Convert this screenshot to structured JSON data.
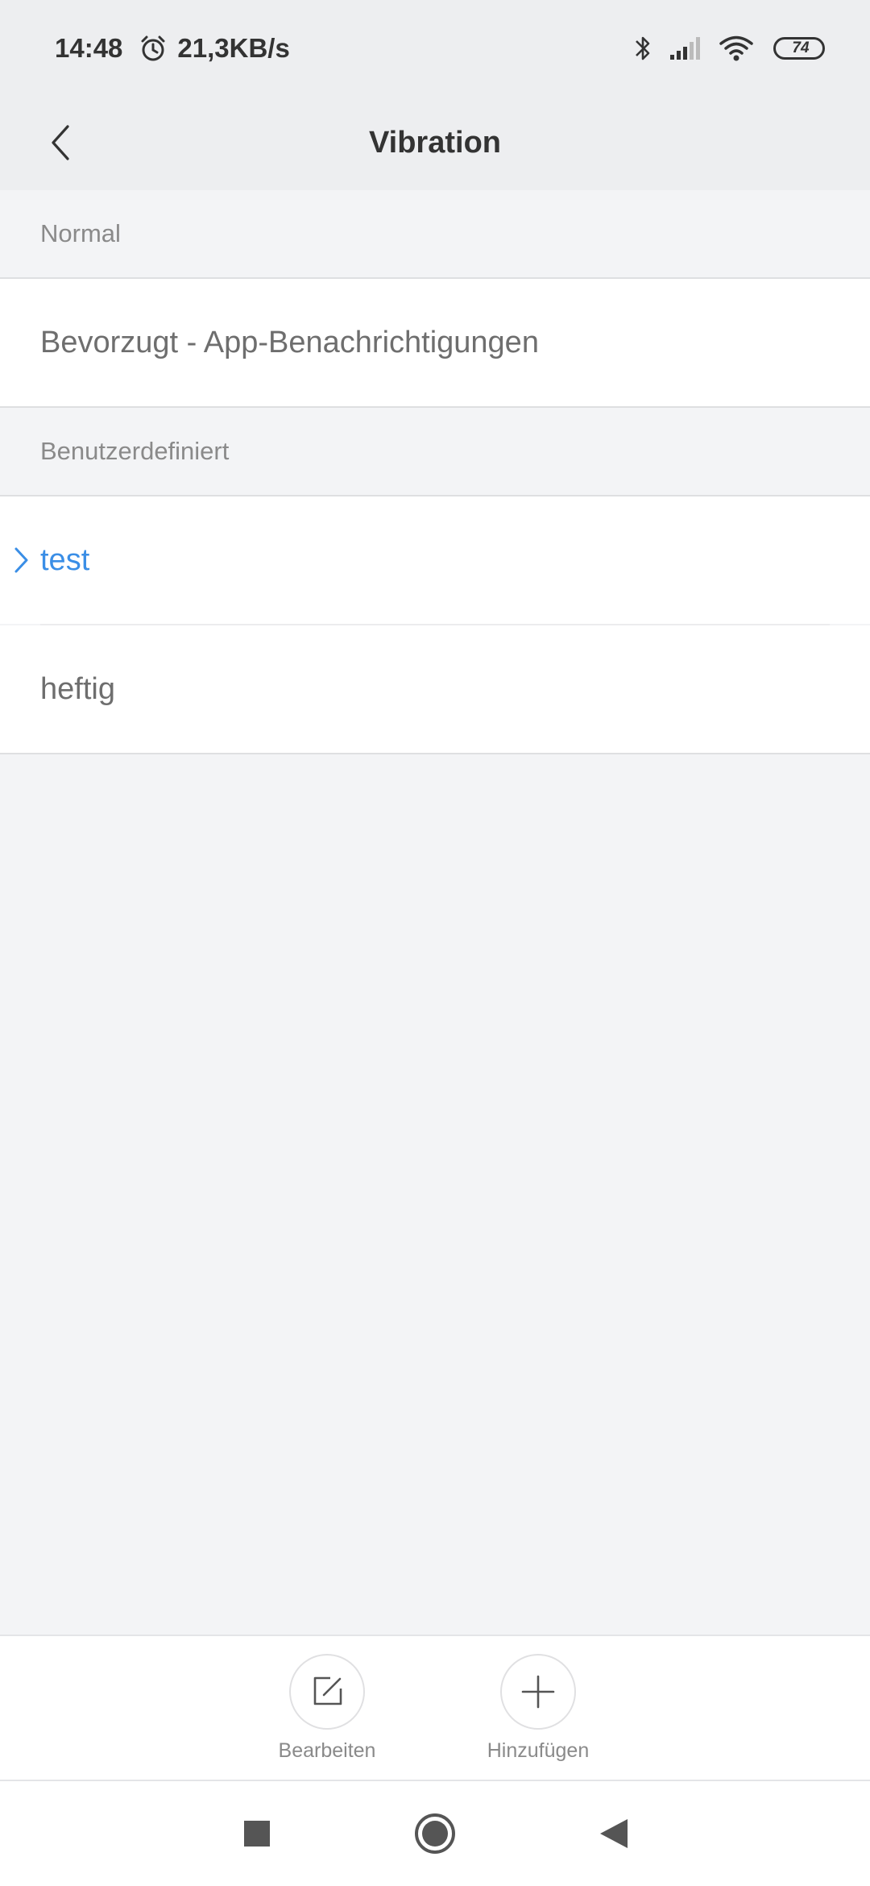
{
  "status_bar": {
    "time": "14:48",
    "alarm_icon": "alarm-clock-icon",
    "network_speed": "21,3KB/s",
    "bluetooth_icon": "bluetooth-icon",
    "signal_icon": "cell-signal-icon",
    "wifi_icon": "wifi-icon",
    "battery_level": "74"
  },
  "header": {
    "back_icon": "chevron-left-icon",
    "title": "Vibration"
  },
  "sections": {
    "normal": {
      "header": "Normal",
      "items": [
        "Bevorzugt - App-Benachrichtigungen"
      ]
    },
    "custom": {
      "header": "Benutzerdefiniert",
      "items": [
        "test",
        "heftig"
      ],
      "selected_item": "test",
      "selected_icon": "chevron-right-icon"
    }
  },
  "actions": {
    "edit_label": "Bearbeiten",
    "edit_icon": "edit-icon",
    "add_label": "Hinzufügen",
    "add_icon": "plus-icon"
  },
  "colors": {
    "accent": "#3a8ee6",
    "background": "#f3f4f6",
    "header_background": "#edeef0"
  },
  "nav_bar": {
    "recents_icon": "square-icon",
    "home_icon": "circle-icon",
    "back_icon": "triangle-back-icon"
  }
}
